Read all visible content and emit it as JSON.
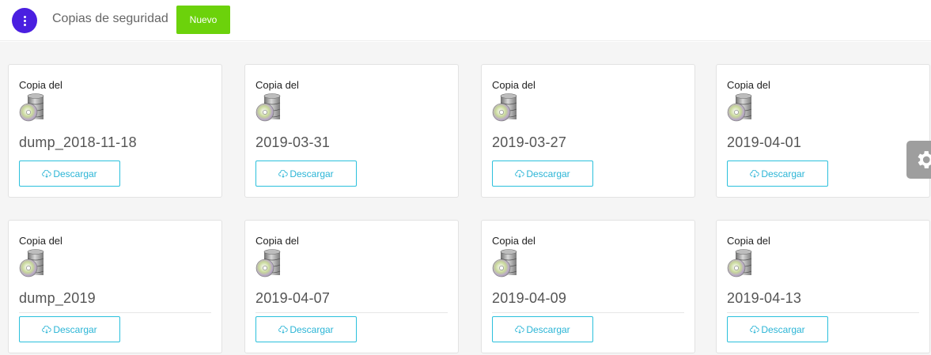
{
  "header": {
    "title": "Copias de seguridad",
    "new_label": "Nuevo"
  },
  "colors": {
    "menu_button": "#4a1fe0",
    "new_button": "#6cd20b",
    "download_accent": "#2bc0dc",
    "settings_tab": "#9e9e9e"
  },
  "cards": [
    {
      "title": "Copia del",
      "name": "dump_2018-11-18",
      "button": "Descargar",
      "icon": "database-disc-icon"
    },
    {
      "title": "Copia del",
      "name": "2019-03-31",
      "button": "Descargar",
      "icon": "database-disc-icon"
    },
    {
      "title": "Copia del",
      "name": "2019-03-27",
      "button": "Descargar",
      "icon": "database-disc-icon"
    },
    {
      "title": "Copia del",
      "name": "2019-04-01",
      "button": "Descargar",
      "icon": "database-disc-icon"
    },
    {
      "title": "Copia del",
      "name": "dump_2019",
      "button": "Descargar",
      "icon": "database-disc-icon"
    },
    {
      "title": "Copia del",
      "name": "2019-04-07",
      "button": "Descargar",
      "icon": "database-disc-icon"
    },
    {
      "title": "Copia del",
      "name": "2019-04-09",
      "button": "Descargar",
      "icon": "database-disc-icon"
    },
    {
      "title": "Copia del",
      "name": "2019-04-13",
      "button": "Descargar",
      "icon": "database-disc-icon"
    }
  ],
  "settings": {
    "icon": "gear-icon"
  }
}
